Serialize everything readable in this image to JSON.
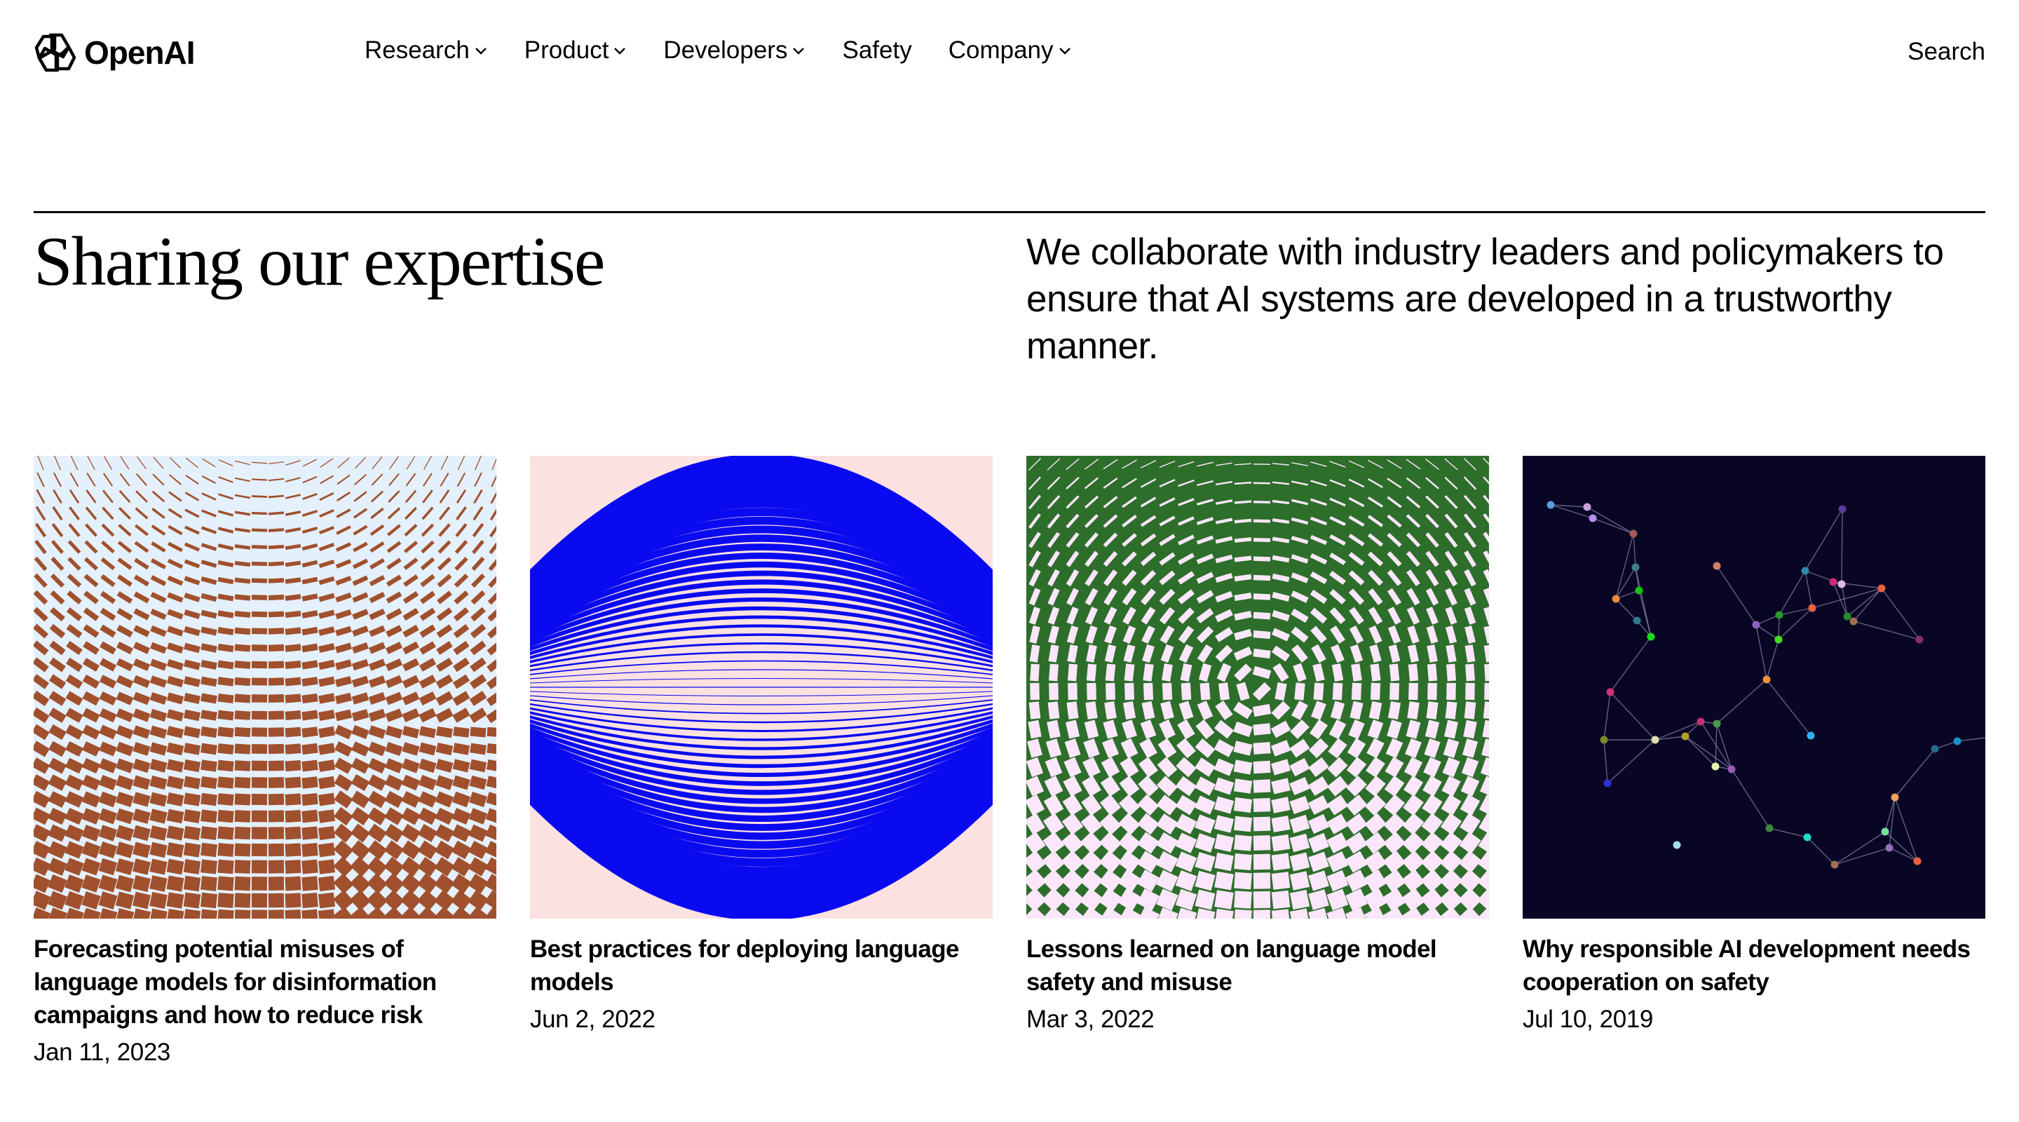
{
  "header": {
    "brand": "OpenAI",
    "logo_icon": "openai-knot-icon",
    "nav": [
      {
        "label": "Research",
        "has_dropdown": true
      },
      {
        "label": "Product",
        "has_dropdown": true
      },
      {
        "label": "Developers",
        "has_dropdown": true
      },
      {
        "label": "Safety",
        "has_dropdown": false
      },
      {
        "label": "Company",
        "has_dropdown": true
      }
    ],
    "search_label": "Search"
  },
  "section": {
    "title": "Sharing our expertise",
    "description": "We collaborate with industry leaders and policymakers to ensure that AI systems are developed in a trustworthy manner."
  },
  "cards": [
    {
      "title": "Forecasting potential misuses of language models for disinformation campaigns and how to reduce risk",
      "date": "Jan 11, 2023",
      "image": {
        "kind": "tile-field",
        "fg": "#A0502D",
        "bg": "#E4F0FB"
      }
    },
    {
      "title": "Best practices for deploying language models",
      "date": "Jun 2, 2022",
      "image": {
        "kind": "arcs",
        "fg": "#0A0AF0",
        "bg": "#FCE1E1"
      }
    },
    {
      "title": "Lessons learned on language model safety and misuse",
      "date": "Mar 3, 2022",
      "image": {
        "kind": "tile-field-center",
        "fg": "#2D6E2A",
        "bg": "#FBE6FB"
      }
    },
    {
      "title": "Why responsible AI development needs cooperation on safety",
      "date": "Jul 10, 2019",
      "image": {
        "kind": "network-graph",
        "fg": "#8A86A8",
        "bg": "#080624"
      }
    }
  ]
}
